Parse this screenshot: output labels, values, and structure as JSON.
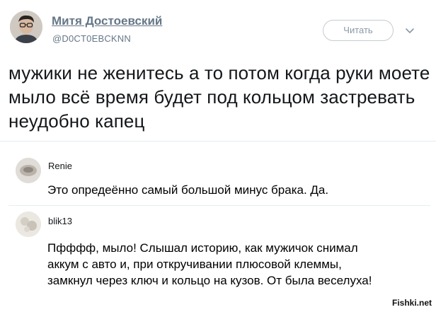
{
  "tweet": {
    "author_name": "Митя Достоевский",
    "author_handle": "@D0CT0EBCKNN",
    "follow_label": "Читать",
    "text": "мужики не женитесь а то потом когда руки моете мыло всё время будет под кольцом застревать неудобно капец"
  },
  "replies": [
    {
      "name": "Renie",
      "text": "Это опредеённо самый большой минус брака. Да."
    },
    {
      "name": "blik13",
      "text": "Пфффф, мыло! Слышал историю, как мужичок снимал\nаккум с авто и, при откручивании плюсовой клеммы,\nзамкнул через ключ и кольцо на кузов. От была веселуха!"
    }
  ],
  "watermark": "Fishki.net",
  "colors": {
    "muted": "#657786",
    "text": "#14171a",
    "divider": "#e6ecf0"
  }
}
